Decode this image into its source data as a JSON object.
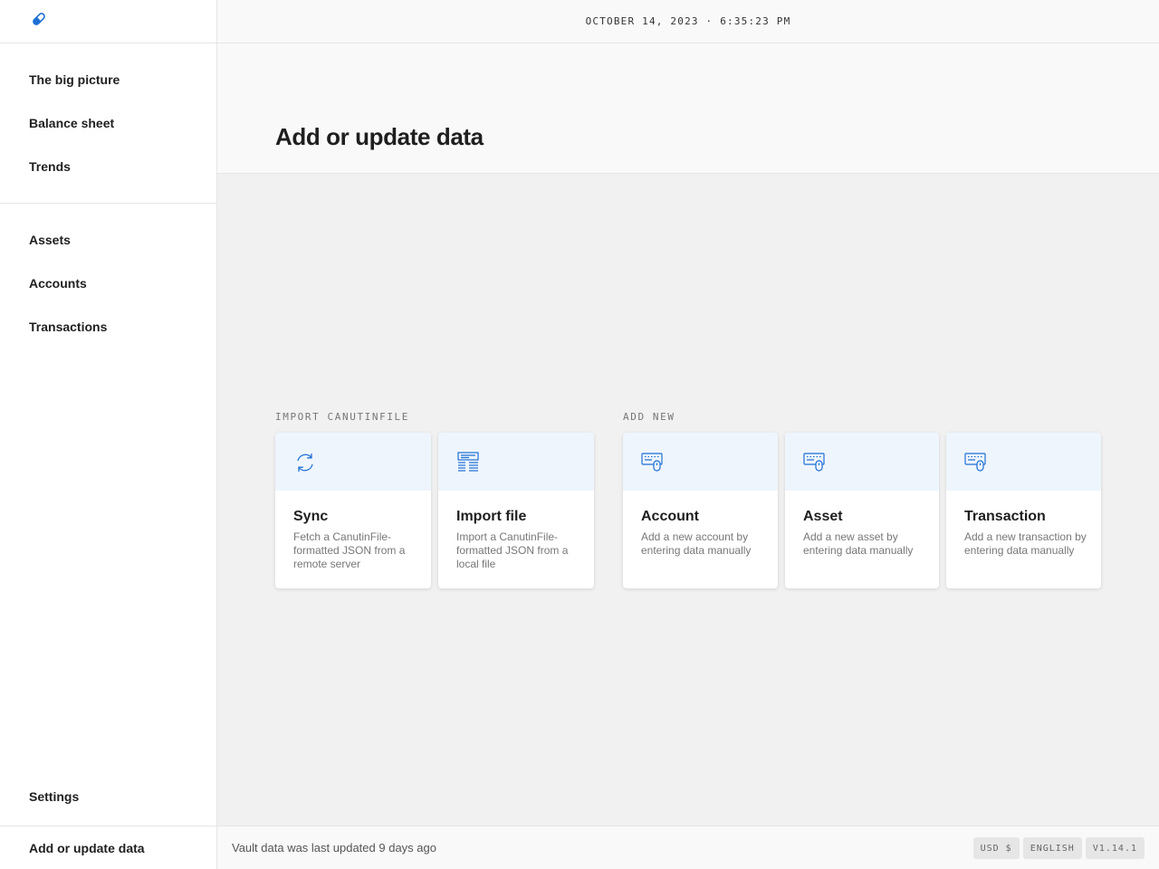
{
  "app": {
    "logo_icon": "pill-icon",
    "brand_color": "#1f6fd4"
  },
  "topbar": {
    "clock": "OCTOBER 14, 2023 · 6:35:23 PM"
  },
  "sidebar": {
    "group1": [
      {
        "label": "The big picture"
      },
      {
        "label": "Balance sheet"
      },
      {
        "label": "Trends"
      }
    ],
    "group2": [
      {
        "label": "Assets"
      },
      {
        "label": "Accounts"
      },
      {
        "label": "Transactions"
      }
    ],
    "settings": "Settings",
    "add_update": "Add or update data"
  },
  "header": {
    "title": "Add or update data"
  },
  "sections": {
    "import": {
      "label": "IMPORT CANUTINFILE",
      "cards": [
        {
          "title": "Sync",
          "description": "Fetch a CanutinFile-formatted JSON from a remote server",
          "icon": "sync-icon"
        },
        {
          "title": "Import file",
          "description": "Import a CanutinFile-formatted JSON from a local file",
          "icon": "document-icon"
        }
      ]
    },
    "add_new": {
      "label": "ADD NEW",
      "cards": [
        {
          "title": "Account",
          "description": "Add a new account by entering data manually",
          "icon": "keyboard-mouse-icon"
        },
        {
          "title": "Asset",
          "description": "Add a new asset by entering data manually",
          "icon": "keyboard-mouse-icon"
        },
        {
          "title": "Transaction",
          "description": "Add a new transaction by entering data manually",
          "icon": "keyboard-mouse-icon"
        }
      ]
    }
  },
  "statusbar": {
    "text": "Vault data was last updated 9 days ago",
    "currency": "USD $",
    "language": "ENGLISH",
    "version": "V1.14.1"
  }
}
